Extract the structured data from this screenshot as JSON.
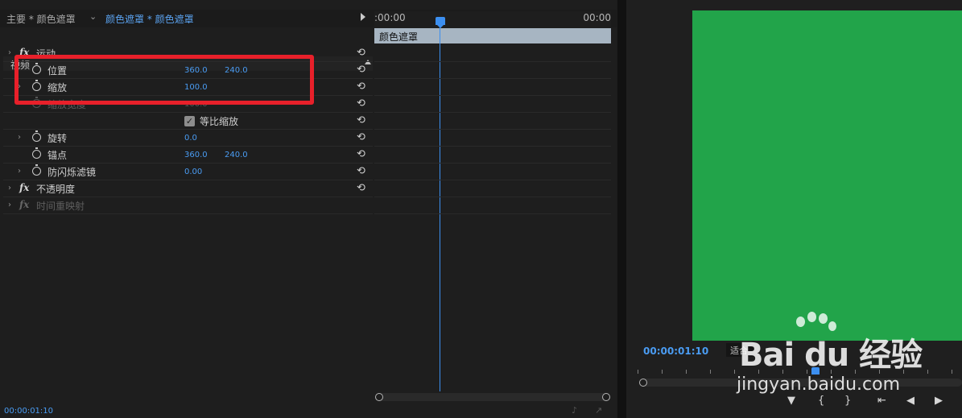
{
  "effect_controls": {
    "tab_master": "主要 * 颜色遮罩",
    "tab_clip": "颜色遮罩 * 颜色遮罩",
    "section_video": "视频",
    "rows": [
      {
        "label": "运动",
        "fx": true
      },
      {
        "label": "位置",
        "value1": "360.0",
        "value2": "240.0"
      },
      {
        "label": "缩放",
        "value1": "100.0"
      },
      {
        "label": "缩放宽度",
        "value1": "100.0",
        "disabled": true
      },
      {
        "label": "等比缩放",
        "checked": true
      },
      {
        "label": "旋转",
        "value1": "0.0"
      },
      {
        "label": "锚点",
        "value1": "360.0",
        "value2": "240.0"
      },
      {
        "label": "防闪烁滤镜",
        "value1": "0.00"
      },
      {
        "label": "不透明度",
        "fx": true
      },
      {
        "label": "时间重映射",
        "fx": true,
        "disabled": true
      }
    ],
    "timeline": {
      "start_time": ":00:00",
      "end_time": "00:00",
      "clip_label": "颜色遮罩"
    },
    "current_time": "00:00:01:10",
    "icons": {
      "stopwatch": "stopwatch-icon",
      "reset": "reset-icon",
      "fx": "fx-badge"
    },
    "highlight_color": "#e8202a",
    "accent_color": "#4a9cf3"
  },
  "program_monitor": {
    "timecode": "00:00:01:10",
    "fit_label": "适合",
    "video_color": "#22a44a",
    "controls": [
      "marker-icon",
      "in-point-icon",
      "out-point-icon",
      "go-to-in-icon",
      "step-back-icon",
      "play-icon"
    ]
  },
  "watermark": {
    "brand": "Bai  du 经验",
    "url": "jingyan.baidu.com"
  }
}
